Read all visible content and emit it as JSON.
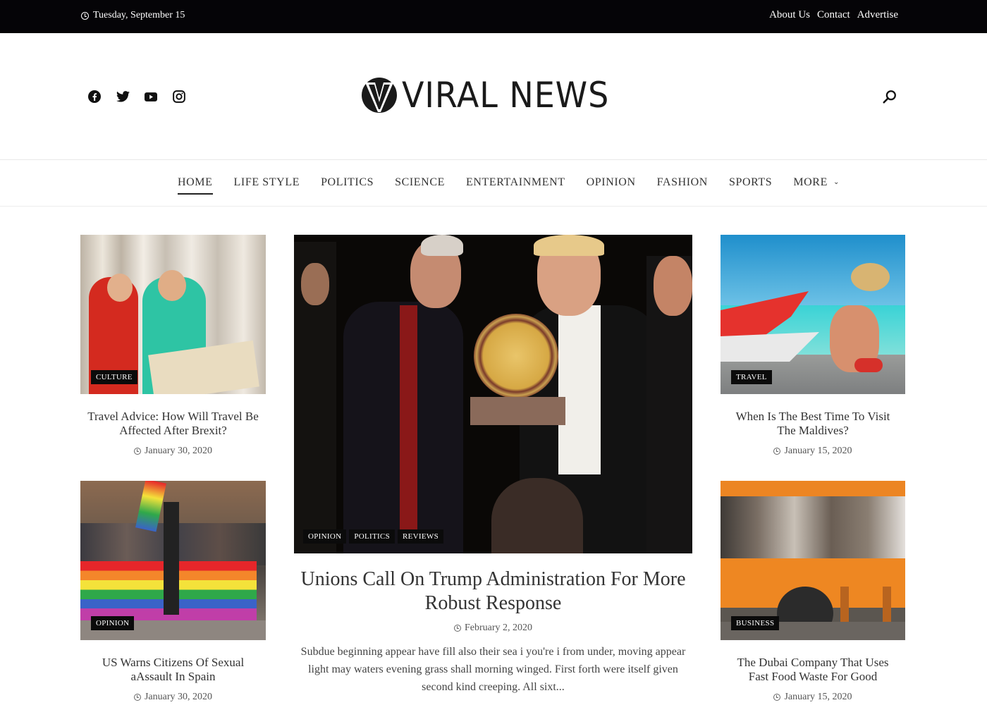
{
  "topbar": {
    "date": "Tuesday, September 15",
    "links": [
      "About Us",
      "Contact",
      "Advertise"
    ]
  },
  "header": {
    "logo_text": "VIRAL NEWS",
    "social_icons": [
      "facebook-icon",
      "twitter-icon",
      "youtube-icon",
      "instagram-icon"
    ],
    "search_icon": "search-icon"
  },
  "nav": {
    "items": [
      {
        "label": "HOME",
        "active": true
      },
      {
        "label": "LIFE STYLE"
      },
      {
        "label": "POLITICS"
      },
      {
        "label": "SCIENCE"
      },
      {
        "label": "ENTERTAINMENT"
      },
      {
        "label": "OPINION"
      },
      {
        "label": "FASHION"
      },
      {
        "label": "SPORTS"
      },
      {
        "label": "MORE",
        "has_dropdown": true
      }
    ]
  },
  "posts": {
    "left": [
      {
        "category": "CULTURE",
        "title": "Travel Advice: How Will Travel Be Affected After Brexit?",
        "date": "January 30, 2020"
      },
      {
        "category": "OPINION",
        "title": "US Warns Citizens Of Sexual aAssault In Spain",
        "date": "January 30, 2020"
      }
    ],
    "right": [
      {
        "category": "TRAVEL",
        "title": "When Is The Best Time To Visit The Maldives?",
        "date": "January 15, 2020"
      },
      {
        "category": "BUSINESS",
        "title": "The Dubai Company That Uses Fast Food Waste For Good",
        "date": "January 15, 2020"
      }
    ],
    "featured": {
      "categories": [
        "OPINION",
        "POLITICS",
        "REVIEWS"
      ],
      "title": "Unions Call On Trump Administration For More Robust Response",
      "date": "February 2, 2020",
      "excerpt": "Subdue beginning appear have fill also their sea i you're i from under, moving appear light may waters evening grass shall morning winged. First forth were itself given second kind creeping. All sixt..."
    }
  }
}
